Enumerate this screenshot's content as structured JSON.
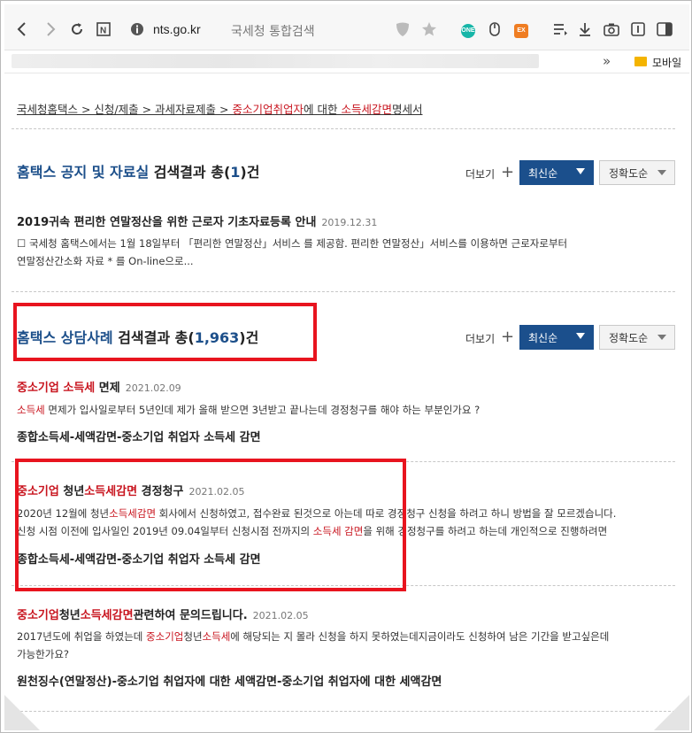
{
  "browser": {
    "url_host": "nts.go.kr",
    "page_title": "국세청 통합검색",
    "bookmark_more": "»",
    "bookmark_folder": "모바일",
    "ext_one": "ONE",
    "ext_ex": "EX",
    "icons": [
      "back-icon",
      "forward-icon",
      "reload-icon",
      "reader-icon",
      "info-icon",
      "shield-icon",
      "star-icon",
      "mouse-icon",
      "list-icon",
      "download-icon",
      "camera-icon",
      "tab-icon",
      "sidebar-icon"
    ]
  },
  "breadcrumb": {
    "pre": "국세청홈택스 > 신청/제출 > 과세자료제출 > ",
    "hl1": "중소기업취업자",
    "mid": "에 대한 ",
    "hl2": "소득세감면",
    "post": "명세서"
  },
  "section1": {
    "title_blue": "홈택스 공지 및 자료실",
    "title_rest": " 검색결과 총(",
    "count": "1",
    "title_end": ")건",
    "more": "더보기",
    "sort_latest": "최신순",
    "sort_accuracy": "정확도순",
    "item": {
      "title": "2019귀속 편리한 연말정산을 위한 근로자 기초자료등록 안내",
      "date": "2019.12.31",
      "desc_line1": "☐ 국세청 홈택스에서는 1월 18일부터 「편리한 연말정산」서비스 를 제공함. 편리한 연말정산」서비스를 이용하면 근로자로부터",
      "desc_line2": "연말정산간소화 자료 * 를 On-line으로..."
    }
  },
  "section2": {
    "title_blue": "홈택스 상담사례",
    "title_rest": " 검색결과 총(",
    "count": "1,963",
    "title_end": ")건",
    "more": "더보기",
    "sort_latest": "최신순",
    "sort_accuracy": "정확도순",
    "item1": {
      "title_hl": "중소기업 소득세",
      "title_rest": " 면제",
      "date": "2021.02.09",
      "desc_hl": "소득세",
      "desc_rest": " 면제가 입사일로부터 5년인데 제가 올해 받으면 3년받고 끝나는데 경정청구를 해야 하는 부분인가요 ?",
      "category": "종합소득세-세액감면-중소기업 취업자 소득세 감면"
    },
    "item2": {
      "title_hl1": "중소기업",
      "title_mid": " 청년",
      "title_hl2": "소득세감면",
      "title_rest": " 경정청구",
      "date": "2021.02.05",
      "line1_a": "2020년 12월에 청년",
      "line1_hl": "소득세감면",
      "line1_b": " 회사에서 신청하였고, 접수완료 된것으로 아는데 따로 경정청구 신청을 하려고 하니 방법을 잘 모르겠습니다.",
      "line2_a": "신청 시점 이전에 입사일인 2019년 09.04일부터 신청시점 전까지의 ",
      "line2_hl": "소득세 감면",
      "line2_b": "을 위해 경정청구를 하려고 하는데 개인적으로 진행하려면",
      "category": "종합소득세-세액감면-중소기업 취업자 소득세 감면"
    },
    "item3": {
      "title_hl1": "중소기업",
      "title_mid": "청년",
      "title_hl2": "소득세감면",
      "title_rest": "관련하여 문의드립니다.",
      "date": "2021.02.05",
      "line1_a": "2017년도에 취업을 하였는데 ",
      "line1_hl1": "중소기업",
      "line1_mid": "청년",
      "line1_hl2": "소득세",
      "line1_b": "에 해당되는 지 몰라 신청을 하지 못하였는데지금이라도 신청하여 남은 기간을 받고싶은데",
      "line2": "가능한가요?",
      "category": "원천징수(연말정산)-중소기업 취업자에 대한 세액감면-중소기업 취업자에 대한 세액감면"
    }
  }
}
